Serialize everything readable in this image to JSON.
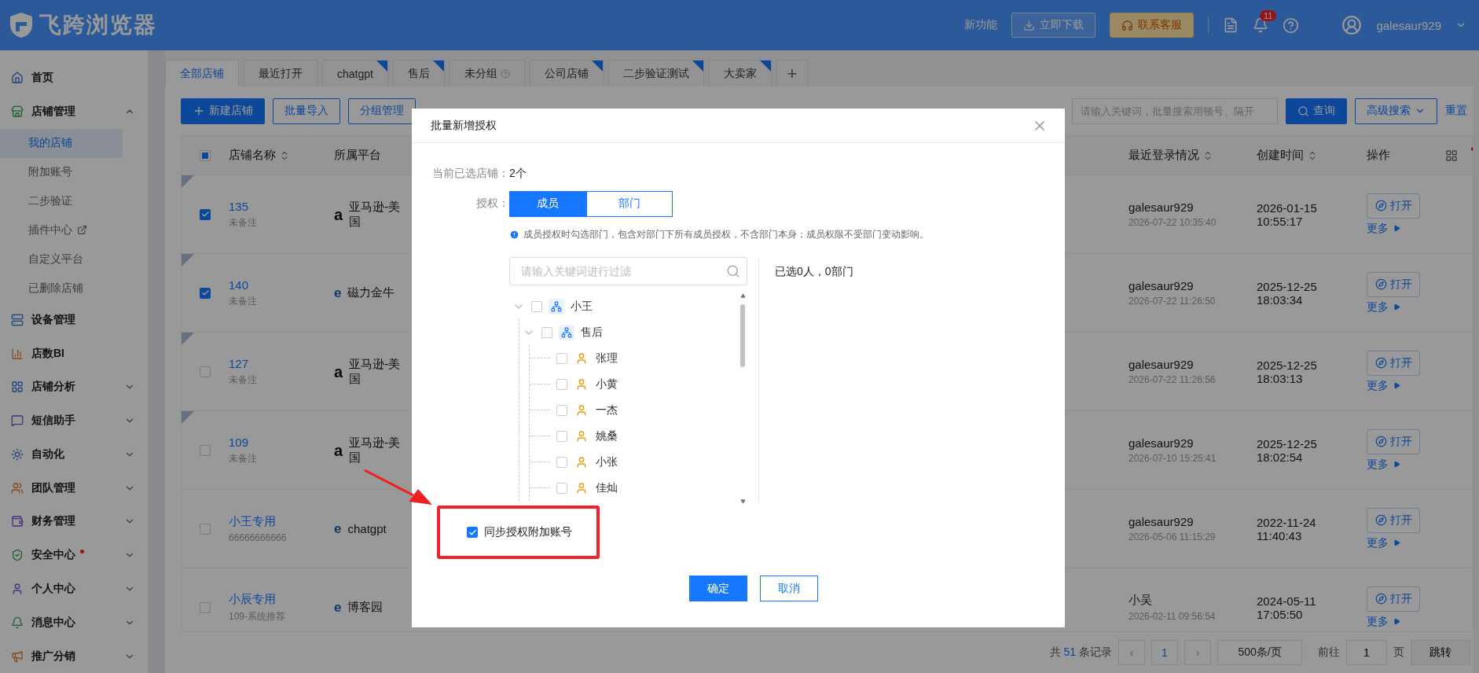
{
  "header": {
    "logo": "飞跨浏览器",
    "new_features": "新功能",
    "download": "立即下载",
    "support": "联系客服",
    "notifications": "11",
    "user": "galesaur929"
  },
  "sidebar": {
    "items": [
      {
        "label": "首页",
        "kind": "link",
        "alert": false
      },
      {
        "label": "店铺管理",
        "kind": "group",
        "expanded": true,
        "alert": false,
        "children": [
          {
            "label": "我的店铺",
            "selected": true,
            "external": false
          },
          {
            "label": "附加账号",
            "selected": false,
            "external": false
          },
          {
            "label": "二步验证",
            "selected": false,
            "external": false
          },
          {
            "label": "插件中心",
            "selected": false,
            "external": true
          },
          {
            "label": "自定义平台",
            "selected": false,
            "external": false
          },
          {
            "label": "已删除店铺",
            "selected": false,
            "external": false
          }
        ]
      },
      {
        "label": "设备管理",
        "kind": "link",
        "alert": false
      },
      {
        "label": "店数BI",
        "kind": "link",
        "alert": false
      },
      {
        "label": "店铺分析",
        "kind": "group",
        "expanded": false,
        "alert": false
      },
      {
        "label": "短信助手",
        "kind": "group",
        "expanded": false,
        "alert": false
      },
      {
        "label": "自动化",
        "kind": "group",
        "expanded": false,
        "alert": false
      },
      {
        "label": "团队管理",
        "kind": "group",
        "expanded": false,
        "alert": false
      },
      {
        "label": "财务管理",
        "kind": "group",
        "expanded": false,
        "alert": false
      },
      {
        "label": "安全中心",
        "kind": "group",
        "expanded": false,
        "alert": true
      },
      {
        "label": "个人中心",
        "kind": "group",
        "expanded": false,
        "alert": false
      },
      {
        "label": "消息中心",
        "kind": "group",
        "expanded": false,
        "alert": false
      },
      {
        "label": "推广分销",
        "kind": "group",
        "expanded": false,
        "alert": false
      }
    ]
  },
  "tabs": [
    {
      "label": "全部店铺",
      "selected": true,
      "marked": false,
      "help": false
    },
    {
      "label": "最近打开",
      "selected": false,
      "marked": false,
      "help": false
    },
    {
      "label": "chatgpt",
      "selected": false,
      "marked": true,
      "help": false
    },
    {
      "label": "售后",
      "selected": false,
      "marked": true,
      "help": false
    },
    {
      "label": "未分组",
      "selected": false,
      "marked": false,
      "help": true
    },
    {
      "label": "公司店铺",
      "selected": false,
      "marked": true,
      "help": false
    },
    {
      "label": "二步验证测试",
      "selected": false,
      "marked": true,
      "help": false
    },
    {
      "label": "大卖家",
      "selected": false,
      "marked": true,
      "help": false
    }
  ],
  "add_tab": "+",
  "toolbar": {
    "buttons": [
      {
        "label": "新建店铺",
        "kind": "primary"
      },
      {
        "label": "批量导入",
        "kind": "outline"
      },
      {
        "label": "分组管理",
        "kind": "outline"
      }
    ],
    "search": {
      "placeholder": "请输入关键词，批量搜索用顿号、隔开"
    },
    "query": "查询",
    "advanced": "高级搜索",
    "reset": "重置"
  },
  "table": {
    "select_all": {
      "indeterminate": true
    },
    "columns": [
      {
        "label": "店铺名称",
        "sortable": true
      },
      {
        "label": "所属平台",
        "sortable": false
      },
      {
        "label": "最近登录情况",
        "sortable": true
      },
      {
        "label": "创建时间",
        "sortable": true
      },
      {
        "label": "操作",
        "sortable": false
      }
    ],
    "rows": [
      {
        "name": "135",
        "note": "未备注",
        "platform": "亚马逊-美国",
        "kind": "amazon",
        "logo": "a",
        "login_user": "galesaur929",
        "login_time": "2026-07-22 10:35:40",
        "created": "2026-01-15 10:55:17",
        "checked": true,
        "flagged": true,
        "open": "打开",
        "more": "更多"
      },
      {
        "name": "140",
        "note": "未备注",
        "platform": "磁力金牛",
        "kind": "web",
        "logo": "e",
        "login_user": "galesaur929",
        "login_time": "2026-07-22 11:26:50",
        "created": "2025-12-25 18:03:34",
        "checked": true,
        "flagged": true,
        "open": "打开",
        "more": "更多"
      },
      {
        "name": "127",
        "note": "未备注",
        "platform": "亚马逊-美国",
        "kind": "amazon",
        "logo": "a",
        "login_user": "galesaur929",
        "login_time": "2026-07-22 11:26:56",
        "created": "2025-12-25 18:03:13",
        "checked": false,
        "flagged": true,
        "open": "打开",
        "more": "更多"
      },
      {
        "name": "109",
        "note": "未备注",
        "platform": "亚马逊-美国",
        "kind": "amazon",
        "logo": "a",
        "login_user": "galesaur929",
        "login_time": "2026-07-10 15:25:41",
        "created": "2025-12-25 18:02:54",
        "checked": false,
        "flagged": true,
        "open": "打开",
        "more": "更多"
      },
      {
        "name": "小王专用",
        "note": "66666666666",
        "platform": "chatgpt",
        "kind": "web",
        "logo": "e",
        "login_user": "galesaur929",
        "login_time": "2026-05-06 11:15:29",
        "created": "2022-11-24 11:40:43",
        "checked": false,
        "flagged": false,
        "open": "打开",
        "more": "更多"
      },
      {
        "name": "小辰专用",
        "note": "109-系统推荐",
        "platform": "博客园",
        "kind": "web",
        "logo": "e",
        "login_user": "小吴",
        "login_time": "2026-02-11 09:56:54",
        "created": "2024-05-11 17:05:50",
        "checked": false,
        "flagged": false,
        "open": "打开",
        "more": "更多"
      }
    ]
  },
  "pagination": {
    "total_prefix": "共",
    "total": "51",
    "total_suffix": "条记录",
    "prev": "‹",
    "pages": [
      {
        "label": "1",
        "selected": true
      }
    ],
    "next": "›",
    "page_size": "500条/页",
    "goto_label": "前往",
    "goto_value": "1",
    "page_unit": "页",
    "jump": "跳转"
  },
  "dialog": {
    "title": "批量新增授权",
    "selected_label": "当前已选店铺：",
    "selected_value": "2个",
    "auth_label": "授权：",
    "auth_options": [
      {
        "label": "成员",
        "selected": true
      },
      {
        "label": "部门",
        "selected": false
      }
    ],
    "info": "成员授权时勾选部门，包含对部门下所有成员授权，不含部门本身；成员权限不受部门变动影响。",
    "filter": {
      "placeholder": "请输入关键词进行过滤"
    },
    "summary": "已选0人，0部门",
    "tree": [
      {
        "label": "小王",
        "kind": "department",
        "expanded": true,
        "checked": false,
        "children": [
          {
            "label": "售后",
            "kind": "department",
            "expanded": true,
            "checked": false,
            "children": [
              {
                "label": "张理",
                "kind": "person",
                "checked": false
              },
              {
                "label": "小黄",
                "kind": "person",
                "checked": false
              },
              {
                "label": "一杰",
                "kind": "person",
                "checked": false
              },
              {
                "label": "姚桑",
                "kind": "person",
                "checked": false
              },
              {
                "label": "小张",
                "kind": "person",
                "checked": false
              },
              {
                "label": "佳灿",
                "kind": "person",
                "checked": false
              }
            ]
          }
        ]
      }
    ],
    "sync": {
      "label": "同步授权附加账号",
      "checked": true
    },
    "buttons": [
      {
        "label": "确定",
        "kind": "primary"
      },
      {
        "label": "取消",
        "kind": "secondary"
      }
    ]
  }
}
